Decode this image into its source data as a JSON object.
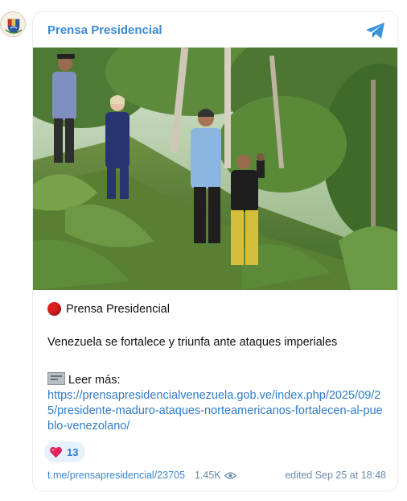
{
  "channel": {
    "name": "Prensa Presidencial",
    "avatar_icon": "venezuela-coat-of-arms-icon"
  },
  "header": {
    "share_icon": "telegram-icon"
  },
  "post": {
    "sender_icon": "red-circle-emoji",
    "sender": "Prensa Presidencial",
    "headline": "Venezuela se fortalece y triunfa ante ataques imperiales",
    "readmore_icon": "newspaper-emoji",
    "readmore_label": "Leer más:",
    "link": "https://prensapresidencialvenezuela.gob.ve/index.php/2025/09/25/presidente-maduro-ataques-norteamericanos-fortalecen-al-pueblo-venezolano/"
  },
  "reaction": {
    "icon": "heart-icon",
    "count": "13"
  },
  "footer": {
    "url": "t.me/prensapresidencial/23705",
    "views": "1.45K",
    "views_icon": "eye-icon",
    "edited": "edited  Sep 25 at 18:48"
  },
  "colors": {
    "accent": "#3a8ad6",
    "link": "#2f7cc6",
    "reaction_bg": "#e6f1fb",
    "heart": "#e0245e"
  }
}
